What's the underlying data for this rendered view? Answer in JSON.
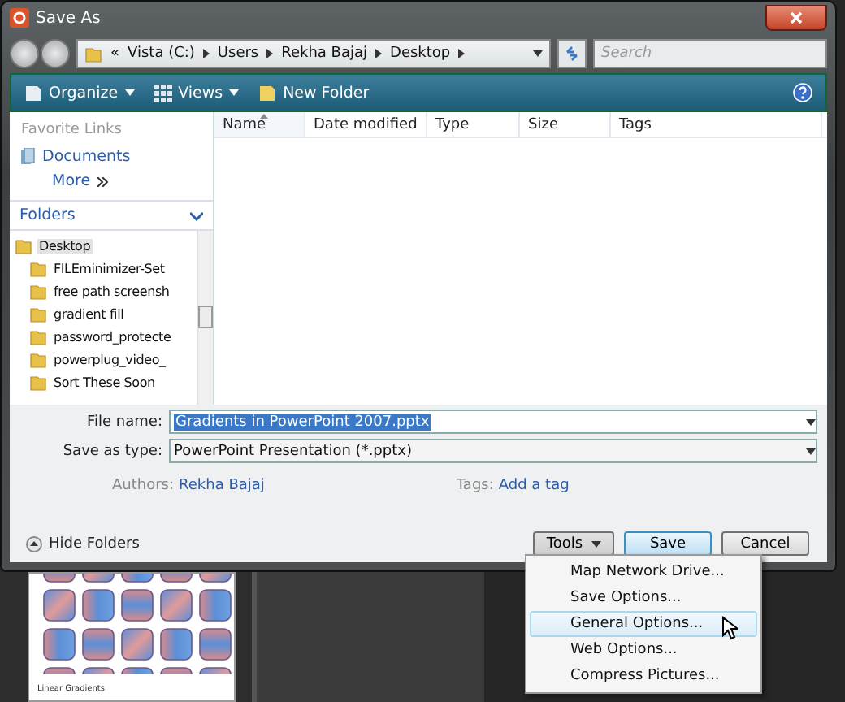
{
  "window": {
    "title": "Save As"
  },
  "address": {
    "overflow": "«",
    "path": [
      "Vista (C:)",
      "Users",
      "Rekha Bajaj",
      "Desktop"
    ]
  },
  "search": {
    "placeholder": "Search"
  },
  "toolbar": {
    "items": [
      {
        "label": "Organize",
        "kind": "dropdown"
      },
      {
        "label": "Views",
        "kind": "dropdown"
      },
      {
        "label": "New Folder",
        "kind": "plain"
      }
    ]
  },
  "favorite_links": {
    "heading": "Favorite Links",
    "items": [
      "Documents"
    ],
    "more": "More"
  },
  "folders": {
    "heading": "Folders",
    "tree": [
      {
        "label": "Desktop",
        "selected": true,
        "children": [
          {
            "label": "FILEminimizer-Set",
            "selected": false
          },
          {
            "label": "free path screensh",
            "selected": false
          },
          {
            "label": "gradient fill",
            "selected": false
          },
          {
            "label": "password_protecte",
            "selected": false
          },
          {
            "label": "powerplug_video_",
            "selected": false
          },
          {
            "label": "Sort These Soon",
            "selected": false
          }
        ]
      }
    ]
  },
  "file_list": {
    "columns": [
      {
        "label": "Name",
        "sorted": true
      },
      {
        "label": "Date modified",
        "sorted": false
      },
      {
        "label": "Type",
        "sorted": false
      },
      {
        "label": "Size",
        "sorted": false
      },
      {
        "label": "Tags",
        "sorted": false
      }
    ]
  },
  "form": {
    "file_name_label": "File name:",
    "file_name": "Gradients in PowerPoint 2007.pptx",
    "type_label": "Save as type:",
    "type": "PowerPoint Presentation (*.pptx)",
    "authors_label": "Authors:",
    "authors": "Rekha Bajaj",
    "tags_label": "Tags:",
    "tags": "Add a tag"
  },
  "hide_folders": "Hide Folders",
  "buttons": [
    {
      "label": "Tools",
      "kind": "menu"
    },
    {
      "label": "Save",
      "kind": "default"
    },
    {
      "label": "Cancel",
      "kind": "normal"
    }
  ],
  "tools_menu": [
    {
      "label": "Map Network Drive...",
      "selected": false
    },
    {
      "label": "Save Options...",
      "selected": false
    },
    {
      "label": "General Options...",
      "selected": true
    },
    {
      "label": "Web Options...",
      "selected": false
    },
    {
      "label": "Compress Pictures...",
      "selected": false
    }
  ],
  "slide_thumbnail": {
    "caption": "Linear Gradients"
  }
}
